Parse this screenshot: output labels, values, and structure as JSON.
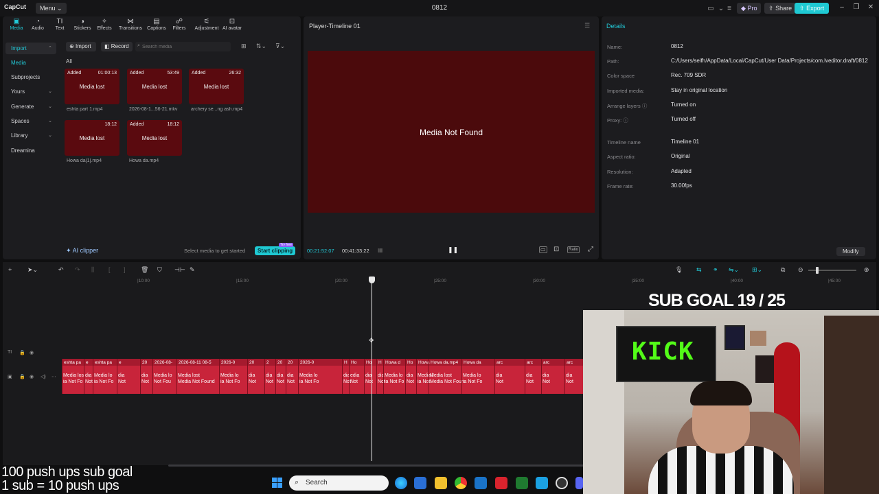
{
  "app": {
    "logo": "CapCut",
    "menu_label": "Menu",
    "project_title": "0812",
    "pro_label": "Pro",
    "share_label": "Share",
    "export_label": "Export",
    "accent_color": "#22c8d6"
  },
  "tool_tabs": [
    {
      "label": "Media",
      "icon": "media-icon",
      "active": true
    },
    {
      "label": "Audio",
      "icon": "audio-icon"
    },
    {
      "label": "Text",
      "icon": "text-icon"
    },
    {
      "label": "Stickers",
      "icon": "stickers-icon"
    },
    {
      "label": "Effects",
      "icon": "effects-icon"
    },
    {
      "label": "Transitions",
      "icon": "transitions-icon"
    },
    {
      "label": "Captions",
      "icon": "captions-icon"
    },
    {
      "label": "Filters",
      "icon": "filters-icon"
    },
    {
      "label": "Adjustment",
      "icon": "adjustment-icon"
    },
    {
      "label": "AI avatar",
      "icon": "ai-avatar-icon"
    }
  ],
  "sidenav": [
    {
      "label": "Import"
    },
    {
      "label": "Media"
    },
    {
      "label": "Subprojects"
    },
    {
      "label": "Yours"
    },
    {
      "label": "Generate"
    },
    {
      "label": "Spaces"
    },
    {
      "label": "Library"
    },
    {
      "label": "Dreamina"
    }
  ],
  "media_bin": {
    "import_label": "Import",
    "record_label": "Record",
    "search_placeholder": "Search media",
    "filter_all": "All",
    "items": [
      {
        "badge": "Added",
        "duration": "01:00:13",
        "status": "Media lost",
        "name": "eshta part 1.mp4"
      },
      {
        "badge": "Added",
        "duration": "53:49",
        "status": "Media lost",
        "name": "2026-08-1...56-21.mkv"
      },
      {
        "badge": "Added",
        "duration": "26:32",
        "status": "Media lost",
        "name": "archery se...ng ash.mp4"
      },
      {
        "badge": "",
        "duration": "18:12",
        "status": "Media lost",
        "name": "Howa da[1].mp4"
      },
      {
        "badge": "Added",
        "duration": "18:12",
        "status": "Media lost",
        "name": "Howa da.mp4"
      }
    ],
    "ai_clipper_label": "AI clipper",
    "select_hint": "Select media to get started",
    "start_clipping_label": "Start clipping",
    "try_free_label": "Try free"
  },
  "player": {
    "title": "Player-Timeline 01",
    "message": "Media Not Found",
    "current_time": "00:21:52:07",
    "total_time": "00:41:33:22",
    "ratio_label": "Ratio"
  },
  "details": {
    "title": "Details",
    "rows": [
      {
        "label": "Name:",
        "value": "0812"
      },
      {
        "label": "Path:",
        "value": "C:/Users/seifh/AppData/Local/CapCut/User Data/Projects/com.lveditor.draft/0812"
      },
      {
        "label": "Color space",
        "value": "Rec. 709 SDR"
      },
      {
        "label": "Imported media:",
        "value": "Stay in original location"
      },
      {
        "label": "Arrange layers",
        "value": "Turned on"
      },
      {
        "label": "Proxy:",
        "value": "Turned off"
      },
      {
        "label": "Timeline name",
        "value": "Timeline 01"
      },
      {
        "label": "Aspect ratio:",
        "value": "Original"
      },
      {
        "label": "Resolution:",
        "value": "Adapted"
      },
      {
        "label": "Frame rate:",
        "value": "30.00fps"
      }
    ],
    "modify_label": "Modify"
  },
  "timeline": {
    "ticks": [
      "|10:00",
      "|15:00",
      "|20:00",
      "|25:00",
      "|30:00",
      "|35:00",
      "|40:00",
      "|45:00"
    ],
    "clips": [
      {
        "top": "eshta pa",
        "bottom": "Media los\nia Not Fo"
      },
      {
        "top": "e",
        "bottom": "dia\nNot"
      },
      {
        "top": "eshta pa",
        "bottom": "Media lo\nia Not Fo"
      },
      {
        "top": "e",
        "bottom": "dia\nNot"
      },
      {
        "top": "20",
        "bottom": "dia\nNot"
      },
      {
        "top": "2026-08-",
        "bottom": "Media lo\nNot Fou"
      },
      {
        "top": "2026-08-11 08-5",
        "bottom": "Media lost\nMedia Not Found"
      },
      {
        "top": "2026-0",
        "bottom": "Media lo\nia Not Fo"
      },
      {
        "top": "20",
        "bottom": "dia\nNot"
      },
      {
        "top": "2",
        "bottom": "dia\nNot"
      },
      {
        "top": "20",
        "bottom": "dia\nNot"
      },
      {
        "top": "20",
        "bottom": "dia\nNot"
      },
      {
        "top": "2026-0",
        "bottom": "Media lo\nia Not Fo"
      },
      {
        "top": "H",
        "bottom": "dia\nNot"
      },
      {
        "top": "Ho",
        "bottom": "edia\nNot"
      },
      {
        "top": "Ho",
        "bottom": "dia\nNot"
      },
      {
        "top": "H",
        "bottom": "dia\nNot"
      },
      {
        "top": "Howa d",
        "bottom": "Media lo\nia Not Fo"
      },
      {
        "top": "Ho",
        "bottom": "dia\nNot"
      },
      {
        "top": "Howa",
        "bottom": "Media l\nia Not"
      },
      {
        "top": "Howa da.mp4",
        "bottom": "Media lost\nMedia Not Foun"
      },
      {
        "top": "Howa da",
        "bottom": "Media lo\nia Not Fo"
      },
      {
        "top": "arc",
        "bottom": "dia\nNot"
      },
      {
        "top": "arc",
        "bottom": "dia\nNot"
      },
      {
        "top": "arc",
        "bottom": "dia\nNot"
      },
      {
        "top": "arc",
        "bottom": "dia\nNot"
      }
    ]
  },
  "overlay": {
    "sub_goal": "SUB GOAL 19 / 25",
    "pushups_line1": "100 push ups sub goal",
    "pushups_line2": "1 sub  = 10 push ups",
    "kick_text": "KICK",
    "kick_color": "#53fc18"
  },
  "taskbar": {
    "search_label": "Search"
  }
}
